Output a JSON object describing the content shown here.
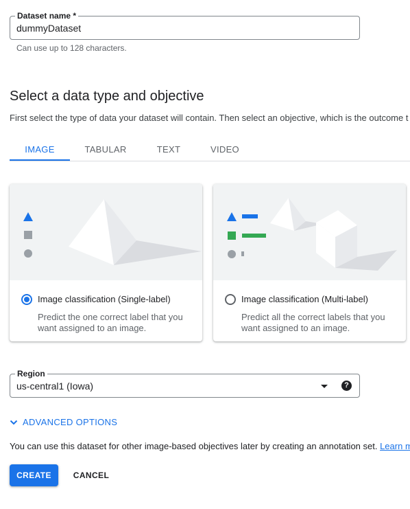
{
  "dataset_name": {
    "label": "Dataset name *",
    "value": "dummyDataset",
    "hint": "Can use up to 128 characters."
  },
  "section": {
    "title": "Select a data type and objective",
    "description": "First select the type of data your dataset will contain. Then select an objective, which is the outcome t"
  },
  "tabs": [
    {
      "label": "IMAGE",
      "active": true
    },
    {
      "label": "TABULAR",
      "active": false
    },
    {
      "label": "TEXT",
      "active": false
    },
    {
      "label": "VIDEO",
      "active": false
    }
  ],
  "cards": [
    {
      "title": "Image classification (Single-label)",
      "description": "Predict the one correct label that you want assigned to an image.",
      "selected": true
    },
    {
      "title": "Image classification (Multi-label)",
      "description": "Predict all the correct labels that you want assigned to an image.",
      "selected": false
    }
  ],
  "region": {
    "label": "Region",
    "value": "us-central1 (Iowa)",
    "help_icon": "?"
  },
  "advanced_options": {
    "label": "ADVANCED OPTIONS",
    "icon": "chevron-down-icon"
  },
  "note": {
    "text": "You can use this dataset for other image-based objectives later by creating an annotation set. ",
    "link": "Learn m"
  },
  "buttons": {
    "create": "CREATE",
    "cancel": "CANCEL"
  },
  "colors": {
    "accent": "#1a73e8",
    "illustration_bg": "#f1f3f4",
    "green": "#34a853",
    "gray_shape": "#9aa0a6"
  }
}
